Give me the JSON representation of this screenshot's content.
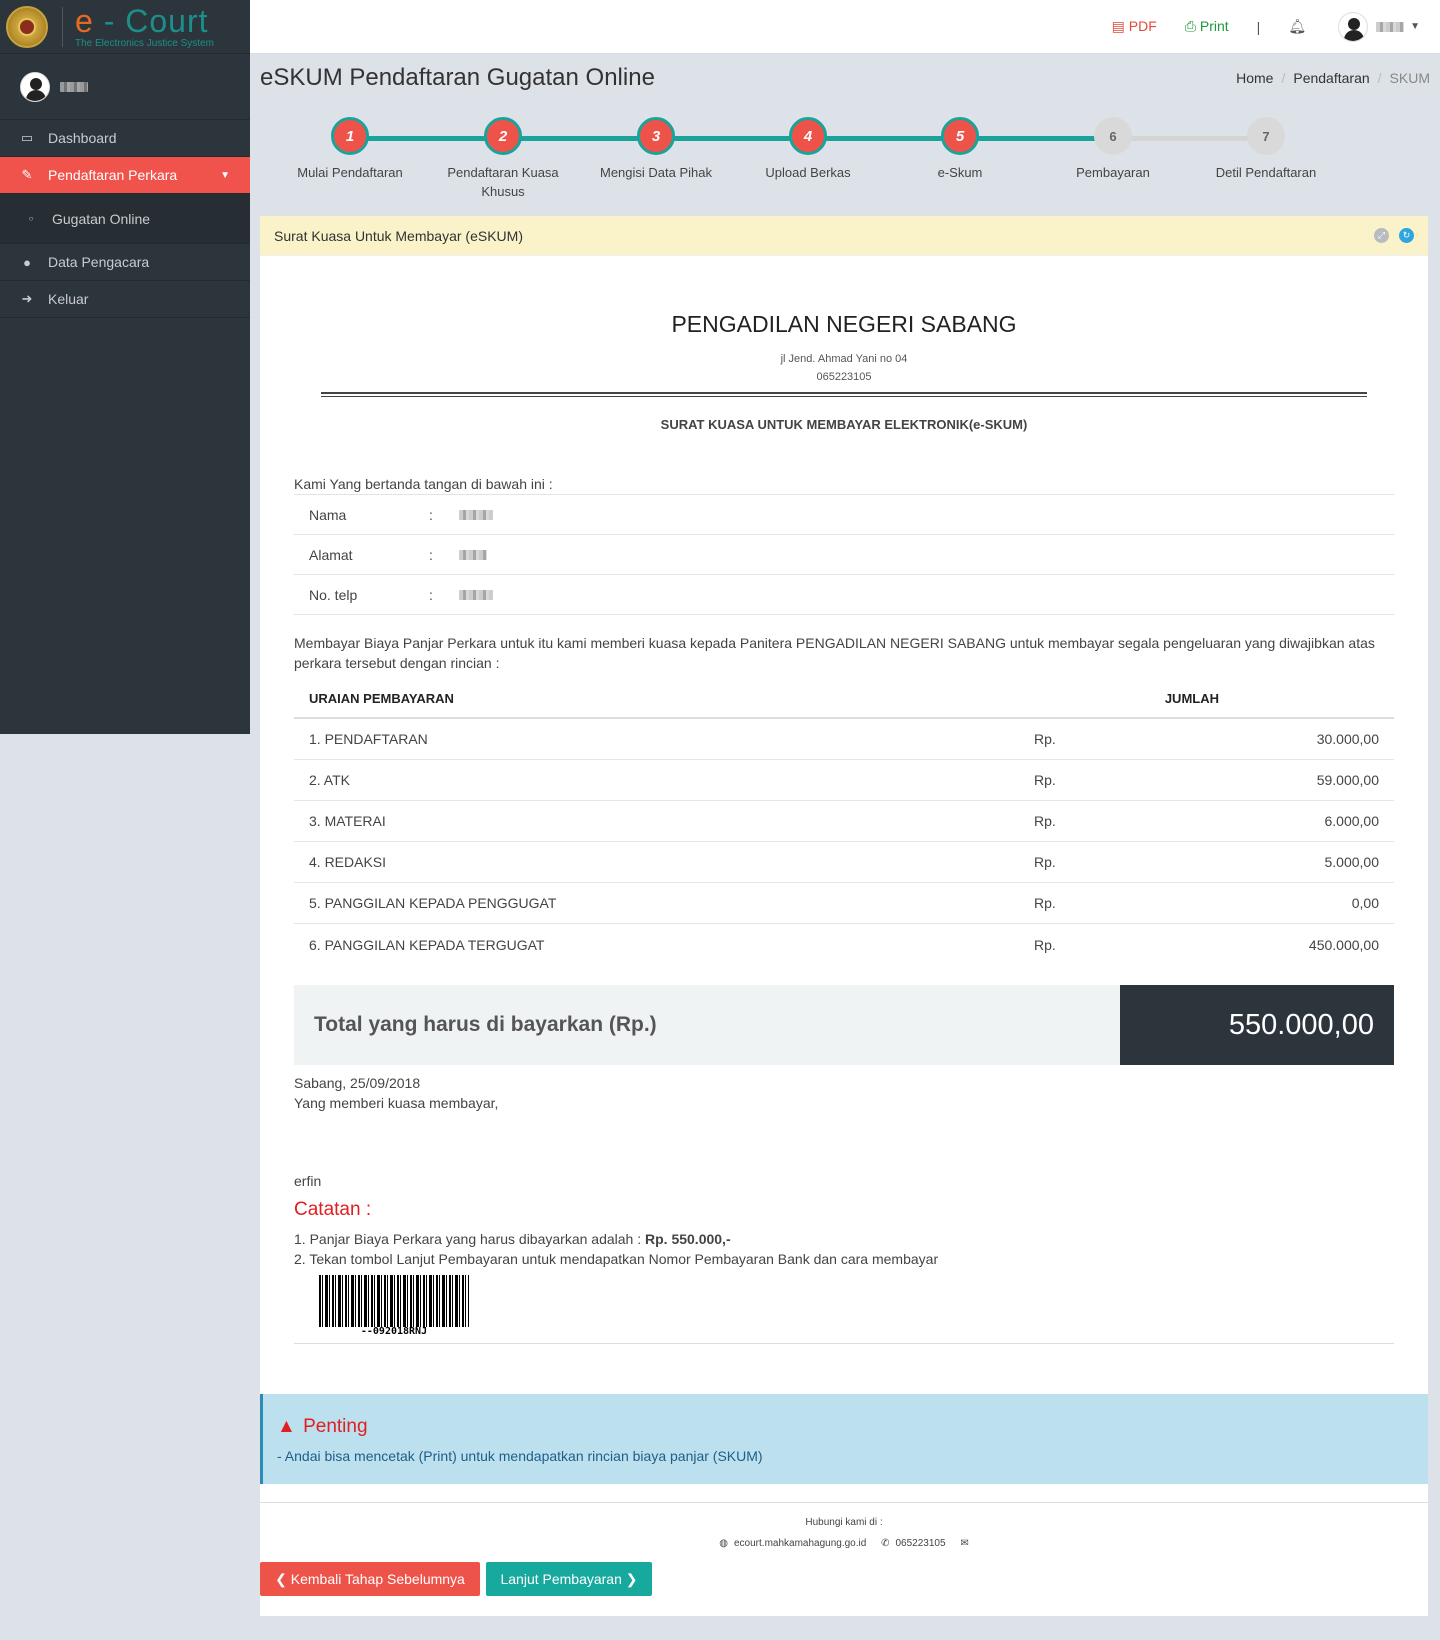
{
  "brand": {
    "title_e": "e",
    "title_rest": " - Court",
    "subtitle": "The Electronics Justice System"
  },
  "sidebar": {
    "items": [
      {
        "label": "Dashboard",
        "icon": "laptop-icon"
      },
      {
        "label": "Pendaftaran Perkara",
        "icon": "edit-icon",
        "active": true
      },
      {
        "label": "Gugatan Online",
        "icon": "circle-icon",
        "sub": true
      },
      {
        "label": "Data Pengacara",
        "icon": "user-icon"
      },
      {
        "label": "Keluar",
        "icon": "sign-out-icon"
      }
    ]
  },
  "topbar": {
    "pdf": "PDF",
    "print": "Print",
    "separator": "|"
  },
  "page": {
    "title": "eSKUM Pendaftaran Gugatan Online"
  },
  "breadcrumb": [
    "Home",
    "Pendaftaran",
    "SKUM"
  ],
  "wizard": {
    "steps": [
      {
        "num": "1",
        "label": "Mulai Pendaftaran",
        "done": true
      },
      {
        "num": "2",
        "label": "Pendaftaran Kuasa Khusus",
        "done": true
      },
      {
        "num": "3",
        "label": "Mengisi Data Pihak",
        "done": true
      },
      {
        "num": "4",
        "label": "Upload Berkas",
        "done": true
      },
      {
        "num": "5",
        "label": "e-Skum",
        "done": true
      },
      {
        "num": "6",
        "label": "Pembayaran",
        "done": false
      },
      {
        "num": "7",
        "label": "Detil Pendaftaran",
        "done": false
      }
    ]
  },
  "panel": {
    "title": "Surat Kuasa Untuk Membayar (eSKUM)"
  },
  "document": {
    "court": "PENGADILAN NEGERI SABANG",
    "address": "jl Jend. Ahmad Yani no 04",
    "phone": "065223105",
    "title": "SURAT KUASA UNTUK MEMBAYAR ELEKTRONIK(e-SKUM)",
    "intro": "Kami Yang bertanda tangan di bawah ini :",
    "identity": [
      {
        "label": "Nama",
        "colon": ":"
      },
      {
        "label": "Alamat",
        "colon": ":"
      },
      {
        "label": "No. telp",
        "colon": ":"
      }
    ],
    "paragraph": "Membayar Biaya Panjar Perkara untuk itu kami memberi kuasa kepada Panitera PENGADILAN NEGERI SABANG untuk membayar segala pengeluaran yang diwajibkan atas perkara tersebut dengan rincian :",
    "fee_header": {
      "uraian": "URAIAN PEMBAYARAN",
      "jumlah": "JUMLAH"
    },
    "fees": [
      {
        "item": "1. PENDAFTARAN",
        "currency": "Rp.",
        "amount": "30.000,00"
      },
      {
        "item": "2. ATK",
        "currency": "Rp.",
        "amount": "59.000,00"
      },
      {
        "item": "3. MATERAI",
        "currency": "Rp.",
        "amount": "6.000,00"
      },
      {
        "item": "4. REDAKSI",
        "currency": "Rp.",
        "amount": "5.000,00"
      },
      {
        "item": "5. PANGGILAN KEPADA PENGGUGAT",
        "currency": "Rp.",
        "amount": "0,00"
      },
      {
        "item": "6. PANGGILAN KEPADA TERGUGAT",
        "currency": "Rp.",
        "amount": "450.000,00"
      }
    ],
    "total_label": "Total yang harus di bayarkan (Rp.)",
    "total_value": "550.000,00",
    "place_date": "Sabang, 25/09/2018",
    "signer_role": "Yang memberi kuasa membayar,",
    "signer_name": "erfin",
    "notes_title": "Catatan :",
    "note1_prefix": "1. Panjar Biaya Perkara yang harus dibayarkan adalah : ",
    "note1_bold": "Rp. 550.000,-",
    "note2": "2. Tekan tombol Lanjut Pembayaran untuk mendapatkan Nomor Pembayaran Bank dan cara membayar",
    "barcode_text": "--092018RNJ"
  },
  "alert": {
    "title": "Penting",
    "message": "- Andai bisa mencetak (Print) untuk mendapatkan rincian biaya panjar (SKUM)"
  },
  "footer": {
    "contact_label": "Hubungi kami di :",
    "website": "ecourt.mahkamahagung.go.id",
    "phone": "065223105"
  },
  "buttons": {
    "back": "Kembali Tahap Sebelumnya",
    "next": "Lanjut Pembayaran"
  },
  "colors": {
    "accent_red": "#ee5349",
    "accent_teal": "#19a39a",
    "sidebar_bg": "#2d353c"
  }
}
